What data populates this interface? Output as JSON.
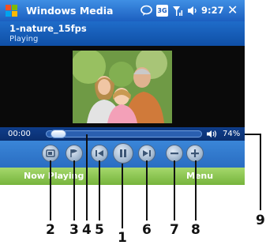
{
  "title_bar": {
    "title": "Windows Media",
    "clock": "9:27",
    "network_badge": "3G",
    "icons": [
      "start-logo-icon",
      "messaging-icon",
      "3g-icon",
      "signal-icon",
      "speaker-icon",
      "close-icon"
    ]
  },
  "clip": {
    "name": "1-nature_15fps",
    "status": "Playing"
  },
  "seek": {
    "time": "00:00",
    "position_fraction": 0.03,
    "volume": "74%"
  },
  "controls": {
    "icons": [
      "screen-size-icon",
      "flag-icon",
      "previous-icon",
      "pause-icon",
      "next-icon",
      "volume-down-icon",
      "volume-up-icon"
    ]
  },
  "menubar": {
    "left": "Now Playing",
    "right": "Menu"
  },
  "callouts": [
    "1",
    "2",
    "3",
    "4",
    "5",
    "6",
    "7",
    "8",
    "9"
  ],
  "colors": {
    "title_bar": "#2a74d6",
    "menu_bar": "#8cc653",
    "controls_bar": "#3179cf",
    "video_bg": "#0a0a0a"
  }
}
